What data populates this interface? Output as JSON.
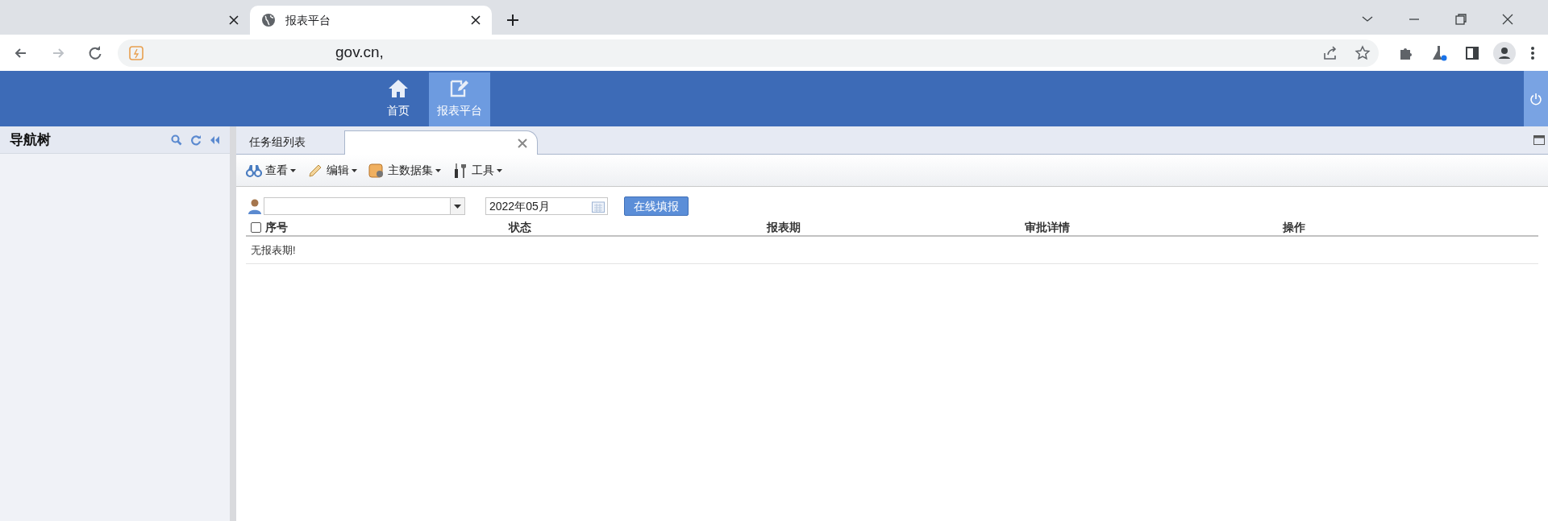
{
  "browser": {
    "tabs": [
      {
        "selected": false
      },
      {
        "title": "报表平台",
        "selected": true
      }
    ],
    "address": "gov.cn,"
  },
  "header": {
    "nav": [
      {
        "label": "首页",
        "kind": "home",
        "selected": false
      },
      {
        "label": "报表平台",
        "kind": "report",
        "selected": true
      }
    ]
  },
  "sidebar": {
    "title": "导航树"
  },
  "content_tabs": [
    {
      "label": "任务组列表",
      "selected": false,
      "closable": false
    },
    {
      "selected": true,
      "closable": true
    }
  ],
  "toolbar": [
    {
      "label": "查看",
      "kind": "view"
    },
    {
      "label": "编辑",
      "kind": "edit"
    },
    {
      "label": "主数据集",
      "kind": "dataset"
    },
    {
      "label": "工具",
      "kind": "tools"
    }
  ],
  "filter": {
    "date": "2022年05月",
    "button": "在线填报"
  },
  "table": {
    "select_all_checked": false,
    "columns": [
      "序号",
      "状态",
      "报表期",
      "审批详情",
      "操作"
    ],
    "empty_message": "无报表期!"
  }
}
